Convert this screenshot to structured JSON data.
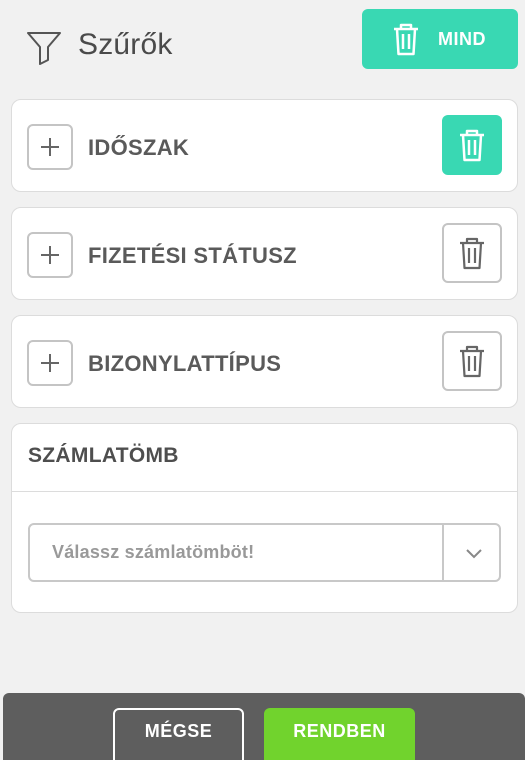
{
  "header": {
    "title": "Szűrők",
    "clear_all_label": "MIND"
  },
  "filters": [
    {
      "label": "IDŐSZAK",
      "trash_state": "active"
    },
    {
      "label": "FIZETÉSI STÁTUSZ",
      "trash_state": "inactive"
    },
    {
      "label": "BIZONYLATTÍPUS",
      "trash_state": "inactive"
    }
  ],
  "invoice_block": {
    "title": "SZÁMLATÖMB",
    "select_placeholder": "Válassz számlatömböt!"
  },
  "footer": {
    "cancel_label": "MÉGSE",
    "ok_label": "RENDBEN"
  },
  "colors": {
    "accent": "#39d8b3",
    "confirm": "#71d32d",
    "footer_bg": "#5e5e5e"
  },
  "icons": {
    "filter": "funnel-icon",
    "trash": "trash-icon",
    "plus": "plus-icon",
    "dropdown": "chevron-down-icon"
  }
}
